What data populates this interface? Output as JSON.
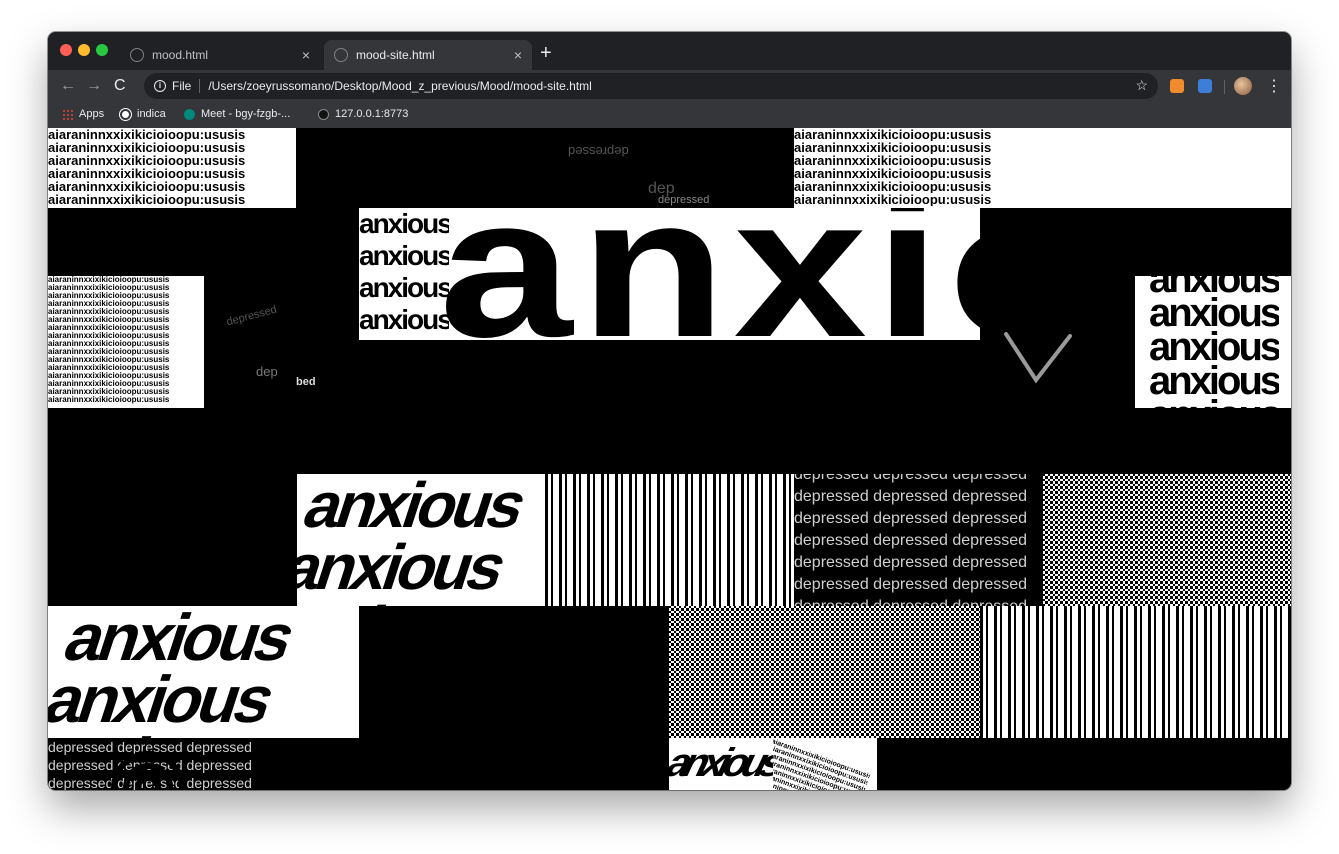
{
  "browser": {
    "tabs": [
      {
        "title": "mood.html",
        "active": false
      },
      {
        "title": "mood-site.html",
        "active": true
      }
    ],
    "new_tab_glyph": "+",
    "close_glyph": "×",
    "nav": {
      "back_glyph": "←",
      "forward_glyph": "→",
      "reload_glyph": "C"
    },
    "address": {
      "scheme_label": "File",
      "url": "/Users/zoeyrussomano/Desktop/Mood_z_previous/Mood/mood-site.html",
      "star_glyph": "☆",
      "info_glyph": "i"
    },
    "menu_glyph": "⋮",
    "bookmarks": [
      {
        "label": "Apps",
        "icon": "apps-grid-icon"
      },
      {
        "label": "indica",
        "icon": "globe-icon"
      },
      {
        "label": "Meet - bgy-fzgb-...",
        "icon": "meet-icon"
      },
      {
        "label": "127.0.0.1:8773",
        "icon": "play-icon"
      }
    ]
  },
  "page": {
    "words": {
      "alphabet_line": "aiaraninnxxixikicioioopu:ususis",
      "anxious": "anxious",
      "depressed_row": "depressed depressed depressed",
      "depressed": "depressed",
      "dep": "dep",
      "bed": "bed"
    }
  }
}
